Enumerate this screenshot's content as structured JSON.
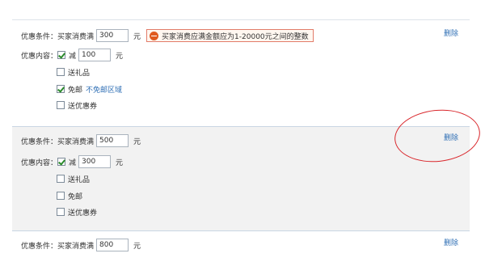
{
  "delete_label": "删除",
  "condition_label": "优惠条件：",
  "condition_prefix": "买家消费满",
  "content_label": "优惠内容：",
  "yuan": "元",
  "reduce_label": "减",
  "gift_label": "送礼品",
  "free_shipping_label": "免邮",
  "coupon_label": "送优惠券",
  "blocks": [
    {
      "threshold": "300",
      "error_text": "买家消费应满金额应为1-20000元之间的整数",
      "reduce": {
        "checked": true,
        "value": "100"
      },
      "gift": {
        "checked": false
      },
      "free_shipping": {
        "checked": true,
        "region_link": "不免邮区域"
      },
      "coupon": {
        "checked": false
      }
    },
    {
      "threshold": "500",
      "reduce": {
        "checked": true,
        "value": "300"
      },
      "gift": {
        "checked": false
      },
      "free_shipping": {
        "checked": false
      },
      "coupon": {
        "checked": false
      }
    },
    {
      "threshold": "800"
    }
  ],
  "colors": {
    "link": "#2f6fb5",
    "error_border": "#e27c6a",
    "error_icon": "#e05a1e",
    "annotation": "#d9262b",
    "shaded_bg": "#f2f2f2"
  }
}
